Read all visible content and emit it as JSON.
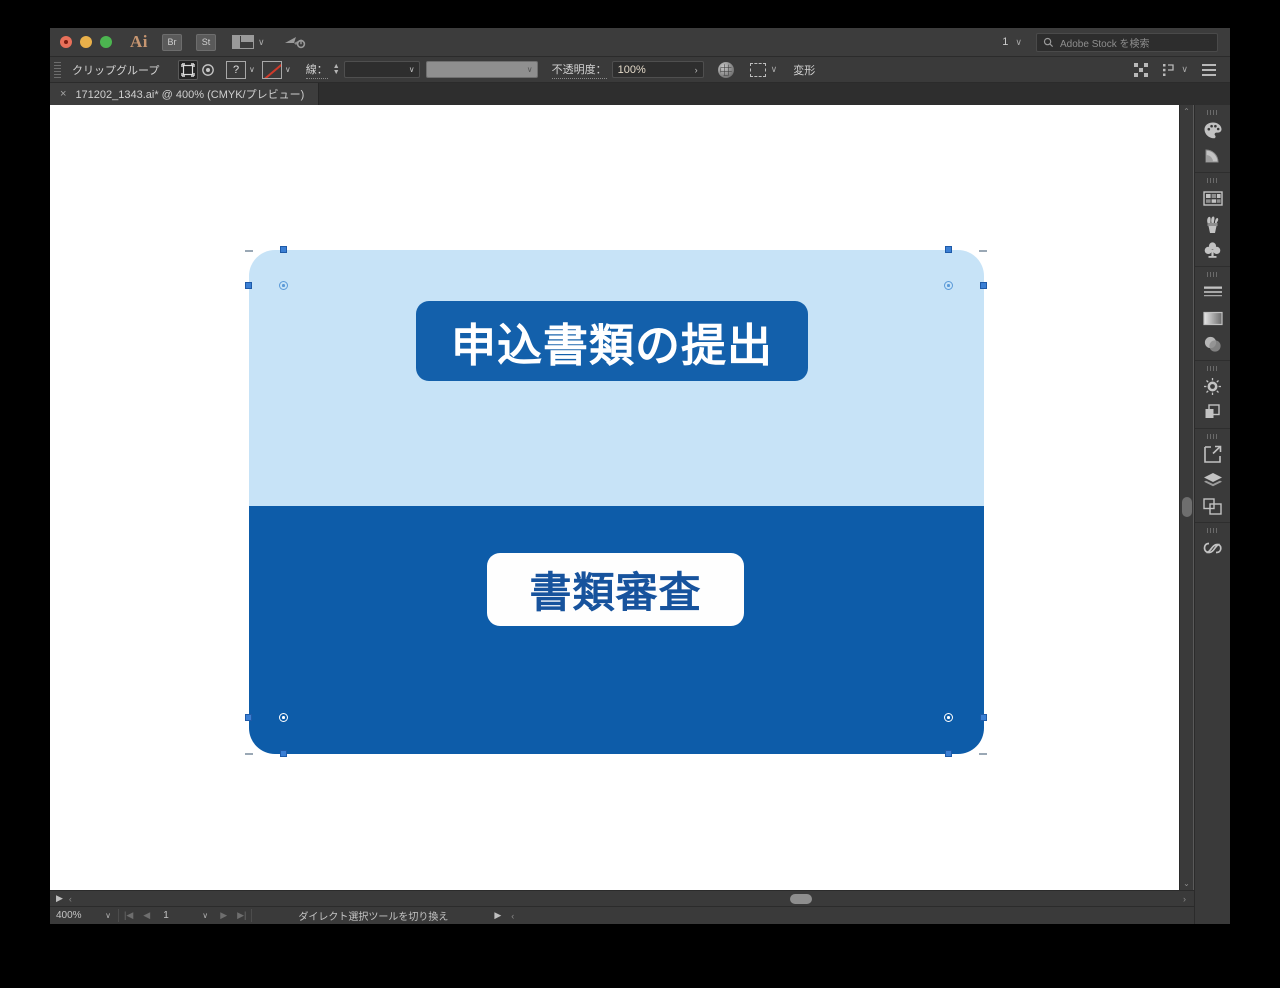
{
  "app": {
    "name": "Adobe Illustrator",
    "logo_text": "Ai",
    "accent_color": "#c79671"
  },
  "titlebar": {
    "bridge_button": "Br",
    "stock_button": "St",
    "arrange_icon": "arrange-documents-icon",
    "cloud_icon": "cloud-sync-icon",
    "page_selector": "1",
    "search": {
      "placeholder": "Adobe Stock を検索",
      "icon": "search-icon"
    }
  },
  "controlbar": {
    "selection_label": "クリップグループ",
    "isolate_icon": "isolation-mode-icon",
    "target_icon": "target-indicator-icon",
    "fill_swatch_label": "?",
    "stroke_label": "線：",
    "stroke_weight": "",
    "stroke_profile": "",
    "opacity_label": "不透明度：",
    "opacity_value": "100%",
    "opacity_caret": "›",
    "style_icon": "graphic-style-sphere-icon",
    "select_similar_icon": "select-similar-objects-icon",
    "transform_label": "変形",
    "align_icon": "align-objects-icon",
    "distribute_icon": "distribute-spacing-icon",
    "doc_setup_icon": "document-setup-icon"
  },
  "tabbar": {
    "close_glyph": "×",
    "document_title": "171202_1343.ai* @ 400% (CMYK/プレビュー)"
  },
  "artwork": {
    "canvas_background": "#ffffff",
    "artboard_top_color": "#c7e3f7",
    "artboard_bottom_color": "#0d5ca9",
    "pill_top": {
      "text": "申込書類の提出",
      "background": "#1360ab",
      "text_color": "#ffffff"
    },
    "pill_bottom": {
      "text": "書類審査",
      "background": "#fefefe",
      "text_color": "#17539d"
    },
    "selection_color": "#3b7fd4"
  },
  "statusbar": {
    "zoom_level": "400%",
    "zoom_chevron": "∨",
    "first_page_icon": "first-page-icon",
    "prev_page_icon": "previous-page-icon",
    "page_number": "1",
    "page_chevron": "∨",
    "next_page_icon": "next-page-icon",
    "last_page_icon": "last-page-icon",
    "status_message": "ダイレクト選択ツールを切り換え",
    "play_glyph": "▶",
    "collapse_glyph": "‹"
  },
  "scrollbars": {
    "vertical_up": "⌃",
    "vertical_down": "⌄",
    "horizontal_left": "‹",
    "horizontal_right": "›",
    "horizontal_play": "▶"
  },
  "dock": {
    "groups": [
      {
        "items": [
          {
            "name": "color-panel-icon",
            "label": "カラー"
          },
          {
            "name": "color-guide-panel-icon",
            "label": "カラーガイド"
          }
        ]
      },
      {
        "items": [
          {
            "name": "swatches-panel-icon",
            "label": "スウォッチ"
          },
          {
            "name": "brushes-panel-icon",
            "label": "ブラシ"
          },
          {
            "name": "symbols-panel-icon",
            "label": "シンボル"
          }
        ]
      },
      {
        "items": [
          {
            "name": "stroke-panel-icon",
            "label": "線"
          },
          {
            "name": "gradient-panel-icon",
            "label": "グラデーション"
          },
          {
            "name": "transparency-panel-icon",
            "label": "透明"
          }
        ]
      },
      {
        "items": [
          {
            "name": "appearance-panel-icon",
            "label": "アピアランス"
          },
          {
            "name": "pathfinder-panel-icon",
            "label": "パスファインダー"
          }
        ]
      },
      {
        "items": [
          {
            "name": "asset-export-panel-icon",
            "label": "アセットの書き出し"
          },
          {
            "name": "layers-panel-icon",
            "label": "レイヤー"
          },
          {
            "name": "artboards-panel-icon",
            "label": "アートボード"
          }
        ]
      },
      {
        "items": [
          {
            "name": "cc-libraries-panel-icon",
            "label": "CC ライブラリ"
          }
        ]
      }
    ]
  }
}
